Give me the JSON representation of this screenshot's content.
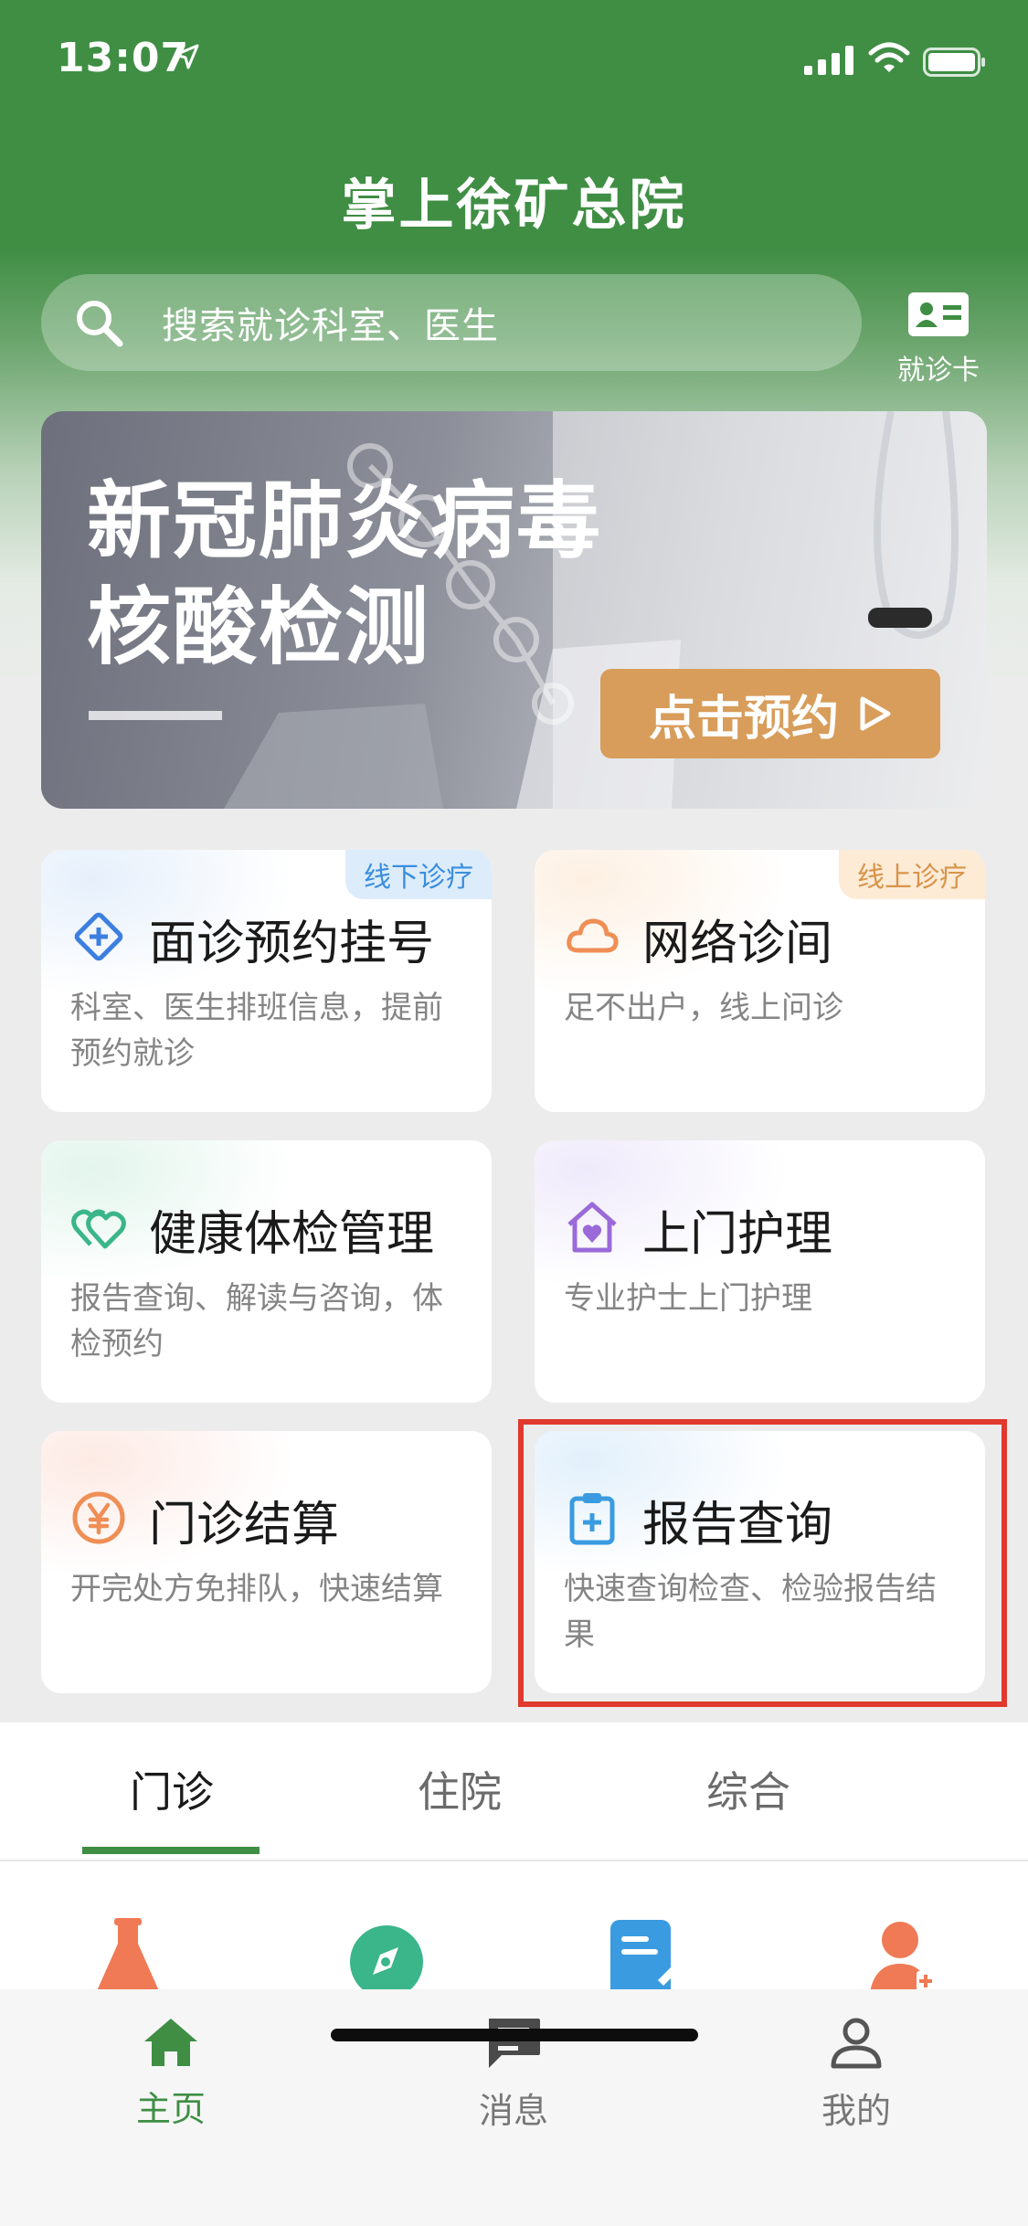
{
  "status_bar": {
    "time": "13:07"
  },
  "header": {
    "title": "掌上徐矿总院"
  },
  "search": {
    "placeholder": "搜索就诊科室、医生"
  },
  "card_button": {
    "label": "就诊卡"
  },
  "banner": {
    "line1": "新冠肺炎病毒",
    "line2": "核酸检测",
    "cta": "点击预约"
  },
  "tiles": [
    {
      "name": "面诊预约挂号",
      "desc": "科室、医生排班信息，提前预约就诊",
      "tag": "线下诊疗",
      "icon": "diamond-plus-icon"
    },
    {
      "name": "网络诊间",
      "desc": "足不出户，线上问诊",
      "tag": "线上诊疗",
      "icon": "cloud-icon"
    },
    {
      "name": "健康体检管理",
      "desc": "报告查询、解读与咨询，体检预约",
      "icon": "hearts-icon"
    },
    {
      "name": "上门护理",
      "desc": "专业护士上门护理",
      "icon": "home-heart-icon"
    },
    {
      "name": "门诊结算",
      "desc": "开完处方免排队，快速结算",
      "icon": "yen-icon"
    },
    {
      "name": "报告查询",
      "desc": "快速查询检查、检验报告结果",
      "icon": "clipboard-plus-icon"
    }
  ],
  "tabs": [
    {
      "label": "门诊"
    },
    {
      "label": "住院"
    },
    {
      "label": "综合"
    }
  ],
  "quick_icons": [
    "flask-icon",
    "compass-icon",
    "document-edit-icon",
    "doctor-icon"
  ],
  "bottom_nav": [
    {
      "label": "主页",
      "icon": "home-icon"
    },
    {
      "label": "消息",
      "icon": "message-icon"
    },
    {
      "label": "我的",
      "icon": "user-icon"
    }
  ],
  "colors": {
    "brand_green": "#3f8e44",
    "cta_orange": "#d89d5b",
    "highlight_red": "#e0392d"
  }
}
